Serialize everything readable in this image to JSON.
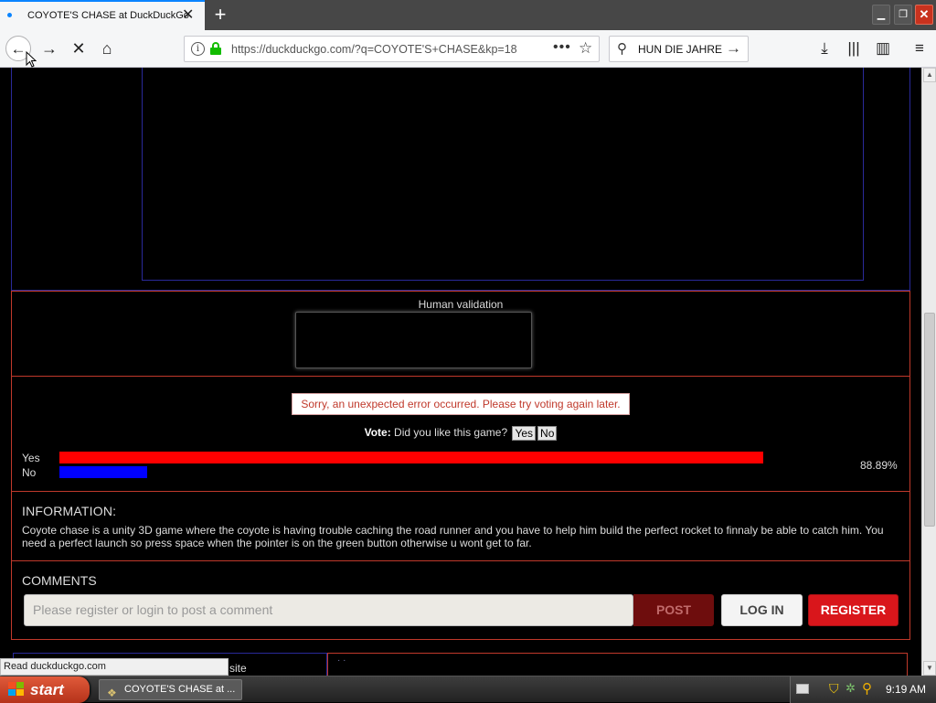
{
  "browser": {
    "tab_title": "COYOTE'S CHASE at DuckDuckGo",
    "new_tab_glyph": "+",
    "url": "https://duckduckgo.com/?q=COYOTE'S+CHASE&kp=18",
    "search_value": "HUN DIE JAHRE",
    "status_text": "Read duckduckgo.com"
  },
  "page": {
    "validation_label": "Human validation",
    "error_message": "Sorry, an unexpected error occurred. Please try voting again later.",
    "vote": {
      "prefix": "Vote:",
      "question": " Did you like this game?",
      "yes_button": "Yes",
      "no_button": "No",
      "yes_label": "Yes",
      "no_label": "No",
      "yes_fraction": 0.8889,
      "no_fraction": 0.1111,
      "percent_text": "88.89%",
      "yes_color": "#ff0000",
      "no_color": "#0000ff"
    },
    "information": {
      "heading": "INFORMATION:",
      "text": "Coyote chase is a unity 3D game where the coyote is having trouble caching the road runner and you have to help him build the perfect rocket to finnaly be able to catch him. You need a perfect launch so press space when the pointer is on the green button otherwise u wont get to far."
    },
    "comments": {
      "heading": "COMMENTS",
      "placeholder": "Please register or login to post a comment",
      "post_label": "POST",
      "login_label": "LOG IN",
      "register_label": "REGISTER"
    },
    "bottom_partial_text": "site"
  },
  "taskbar": {
    "start_label": "start",
    "task_item": "COYOTE'S CHASE at ...",
    "clock": "9:19 AM"
  },
  "colors": {
    "accent_red": "#c0392b",
    "frame_blue": "#2a2a9a",
    "register_red": "#d9161b"
  },
  "icons": [
    "back-icon",
    "forward-icon",
    "stop-icon",
    "home-icon",
    "info-icon",
    "lock-icon",
    "more-icon",
    "bookmark-star-icon",
    "search-icon",
    "search-go-icon",
    "download-icon",
    "library-icon",
    "sidebar-icon",
    "menu-icon"
  ]
}
